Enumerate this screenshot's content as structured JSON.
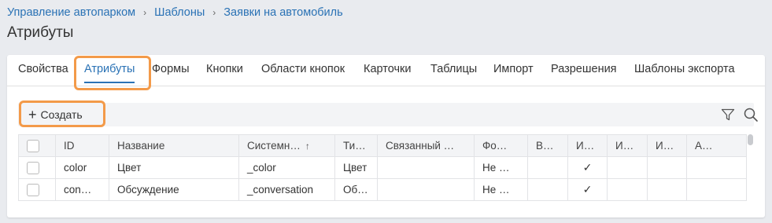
{
  "breadcrumb": {
    "items": [
      "Управление автопарком",
      "Шаблоны",
      "Заявки на автомобиль"
    ],
    "separator": "›"
  },
  "page_title": "Атрибуты",
  "tabs": [
    {
      "label": "Свойства",
      "active": false
    },
    {
      "label": "Атрибуты",
      "active": true
    },
    {
      "label": "Формы",
      "active": false
    },
    {
      "label": "Кнопки",
      "active": false
    },
    {
      "label": "Области кнопок",
      "active": false
    },
    {
      "label": "Карточки",
      "active": false
    },
    {
      "label": "Таблицы",
      "active": false
    },
    {
      "label": "Импорт",
      "active": false
    },
    {
      "label": "Разрешения",
      "active": false
    },
    {
      "label": "Шаблоны экспорта",
      "active": false
    }
  ],
  "toolbar": {
    "create_icon": "plus-icon",
    "create_label": "Создать",
    "filter_icon": "filter-icon",
    "search_icon": "search-icon"
  },
  "table": {
    "columns": [
      "",
      "ID",
      "Название",
      "Системн…",
      "Тип…",
      "Связанный …",
      "Фо…",
      "В…",
      "И…",
      "И…",
      "И…",
      "А…"
    ],
    "sort_indicator": "↑",
    "rows": [
      {
        "id": "color",
        "name": "Цвет",
        "system": "_color",
        "type": "Цвет",
        "linked": "",
        "format": "Не …",
        "c7": "",
        "c8": "✓",
        "c9": "",
        "c10": "",
        "c11": ""
      },
      {
        "id": "con…",
        "name": "Обсуждение",
        "system": "_conversation",
        "type": "Обс…",
        "linked": "",
        "format": "Не …",
        "c7": "",
        "c8": "✓",
        "c9": "",
        "c10": "",
        "c11": ""
      }
    ]
  },
  "colors": {
    "accent": "#2a72b5",
    "highlight": "#f39a49",
    "background": "#e9ebef"
  }
}
